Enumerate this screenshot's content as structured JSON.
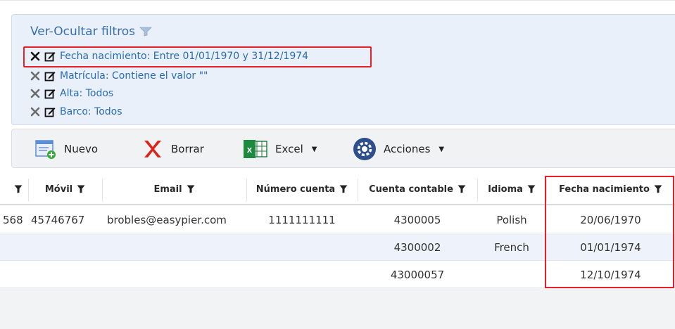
{
  "filters": {
    "title": "Ver-Ocultar filtros",
    "items": [
      {
        "label": "Fecha nacimiento: Entre 01/01/1970 y 31/12/1974"
      },
      {
        "label": "Matrícula: Contiene el valor \"\""
      },
      {
        "label": "Alta: Todos"
      },
      {
        "label": "Barco: Todos"
      }
    ]
  },
  "toolbar": {
    "nuevo": "Nuevo",
    "borrar": "Borrar",
    "excel": "Excel",
    "acciones": "Acciones"
  },
  "table": {
    "columns": [
      "Móvil",
      "Email",
      "Número cuenta",
      "Cuenta contable",
      "Idioma",
      "Fecha nacimiento"
    ],
    "rows": [
      {
        "prev": "568",
        "movil": "45746767",
        "email": "brobles@easypier.com",
        "numero_cuenta": "1111111111",
        "cuenta_contable": "4300005",
        "idioma": "Polish",
        "fecha": "20/06/1970"
      },
      {
        "prev": "",
        "movil": "",
        "email": "",
        "numero_cuenta": "",
        "cuenta_contable": "4300002",
        "idioma": "French",
        "fecha": "01/01/1974"
      },
      {
        "prev": "",
        "movil": "",
        "email": "",
        "numero_cuenta": "",
        "cuenta_contable": "43000057",
        "idioma": "",
        "fecha": "12/10/1974"
      }
    ]
  },
  "colors": {
    "link": "#2b6cb0",
    "panel_bg": "#e9f0f9",
    "highlight": "#e8202a",
    "alt_row": "#eef3fb"
  }
}
